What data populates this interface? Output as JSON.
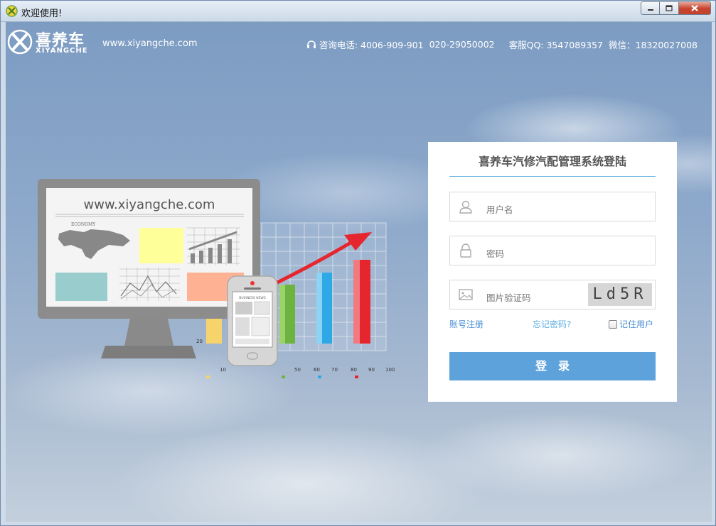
{
  "window": {
    "title": "欢迎使用!"
  },
  "header": {
    "logo_cn": "喜养车",
    "logo_en": "XIYANGCHE",
    "site_url": "www.xiyangche.com",
    "phone_label": "咨询电话: 4006-909-901",
    "phone_2": "020-29050002",
    "qq": "客服QQ: 3547089357",
    "wechat": "微信：18320027008"
  },
  "illustration": {
    "monitor_url": "www.xiyangche.com",
    "economy_label": "ECONOMY",
    "business_news": "BUSINESS NEWS",
    "chart_ticks": [
      "10",
      "50",
      "60",
      "70",
      "80",
      "90",
      "100"
    ],
    "y_tick": "20"
  },
  "login": {
    "title": "喜养车汽修汽配管理系统登陆",
    "username_placeholder": "用户名",
    "password_placeholder": "密码",
    "captcha_placeholder": "图片验证码",
    "captcha_text": "Ld5R",
    "register_link": "账号注册",
    "forgot_link": "忘记密码?",
    "remember_label": "记住用户",
    "submit_label": "登录"
  },
  "colors": {
    "accent": "#5ea2dc",
    "title_line": "#67b4dd",
    "link": "#4b8fd5"
  }
}
